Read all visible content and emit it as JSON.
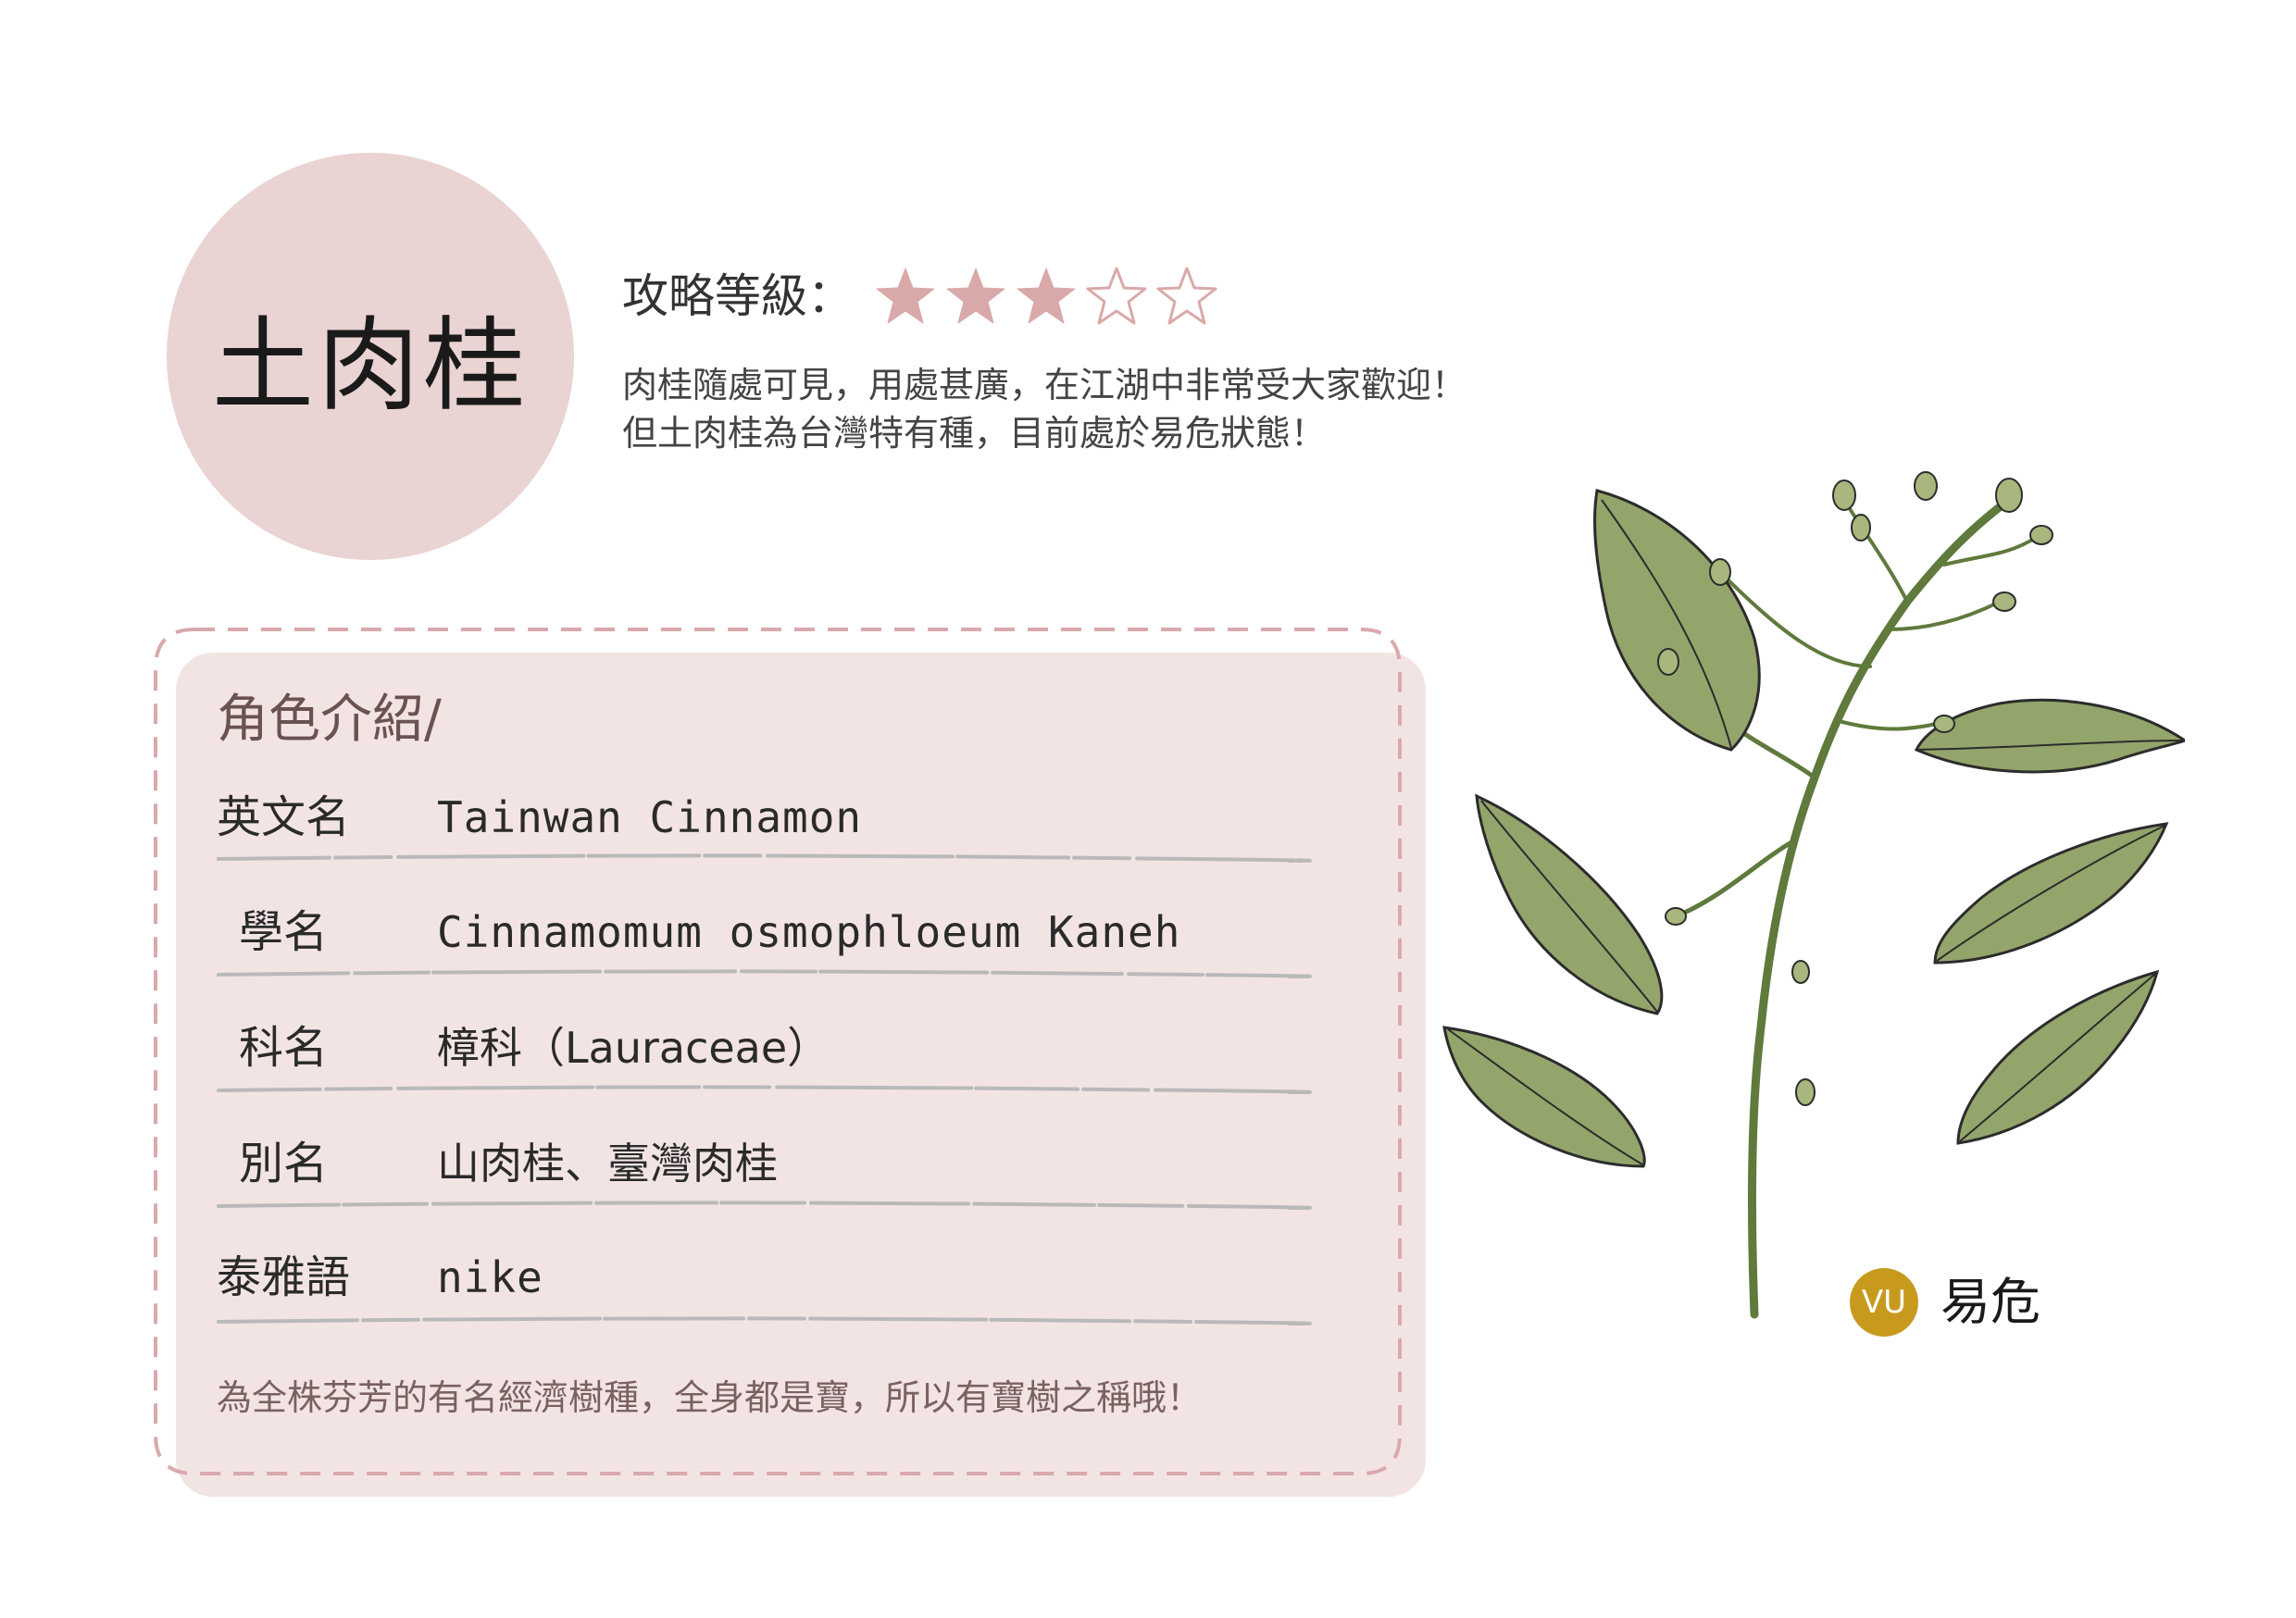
{
  "title": "土肉桂",
  "rating": {
    "label": "攻略等級：",
    "value": 3,
    "max": 5
  },
  "intro": {
    "line1": "肉桂隨處可見，用處甚廣，在江湖中非常受大家歡迎！",
    "line2": "但土肉桂為台灣特有種，目前處於易危狀態！"
  },
  "profile": {
    "heading": "角色介紹/",
    "rows": [
      {
        "label": "英文名",
        "value": "Tainwan Cinnamon"
      },
      {
        "label": "學名",
        "value": "Cinnamomum osmophloeum Kaneh"
      },
      {
        "label": "科名",
        "value": "樟科（Lauraceae）"
      },
      {
        "label": "別名",
        "value": "山肉桂、臺灣肉桂"
      },
      {
        "label": "泰雅語",
        "value": "nike"
      }
    ],
    "note": "為全株芬芳的有名經濟樹種，全身都是寶，所以有寶樹之稱哦！"
  },
  "status": {
    "code": "VU",
    "label": "易危"
  },
  "colors": {
    "accent_pink": "#ead3d3",
    "star_fill": "#d9a9a9",
    "leaf_green": "#93a56b",
    "status_gold": "#c79a1e"
  }
}
